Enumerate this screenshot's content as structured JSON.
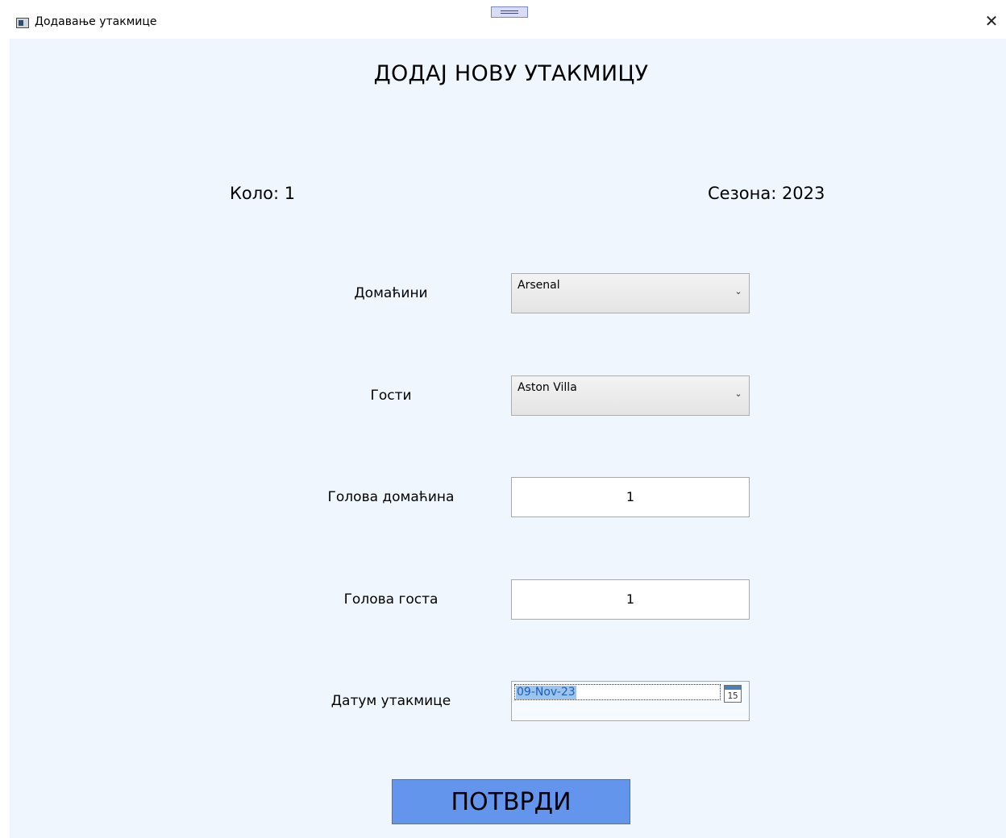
{
  "window": {
    "title": "Додавање утакмице",
    "close_glyph": "✕"
  },
  "form": {
    "title": "ДОДАЈ НОВУ УТАКМИЦУ",
    "round_label": "Коло: 1",
    "season_label": "Сезона: 2023",
    "fields": {
      "home_label": "Домаћини",
      "home_value": "Arsenal",
      "away_label": "Гости",
      "away_value": "Aston Villa",
      "home_goals_label": "Голова домаћина",
      "home_goals_value": "1",
      "away_goals_label": "Голова госта",
      "away_goals_value": "1",
      "date_label": "Датум утакмице",
      "date_value": "09-Nov-23",
      "calendar_day": "15"
    },
    "submit_label": "ПОТВРДИ",
    "dropdown_glyph": "⌄"
  },
  "colors": {
    "client_bg": "#eff6fe",
    "submit_bg": "#6495ed"
  }
}
